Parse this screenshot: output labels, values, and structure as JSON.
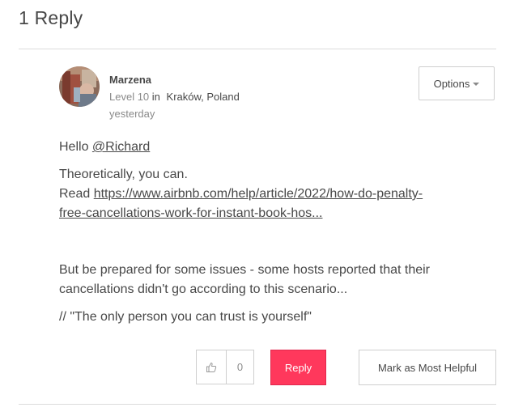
{
  "thread": {
    "replies_heading": "1 Reply"
  },
  "post": {
    "author": "Marzena",
    "rank": "Level 10",
    "location_prefix": "in",
    "location": "Kraków, Poland",
    "timestamp": "yesterday",
    "options_label": "Options",
    "greeting": "Hello ",
    "mention": "@Richard",
    "line_can": "Theoretically, you can.",
    "read_prefix": "Read ",
    "link_text_1": "https://www.airbnb.com/help/article/2022/how-do-penalty-",
    "link_text_2": "free-cancellations-work-for-instant-book-hos...",
    "warning": "But be prepared for some issues - some hosts reported that their cancellations didn't go according to this scenario...",
    "signature": "// \"The only person you can trust is yourself\""
  },
  "actions": {
    "kudos_icon": "thumbs-up-icon",
    "kudos_count": "0",
    "reply_label": "Reply",
    "helpful_label": "Mark as Most Helpful"
  },
  "colors": {
    "accent": "#ff385c",
    "text": "#484848",
    "muted": "#8a8a8a",
    "border": "#cfcfcf"
  }
}
